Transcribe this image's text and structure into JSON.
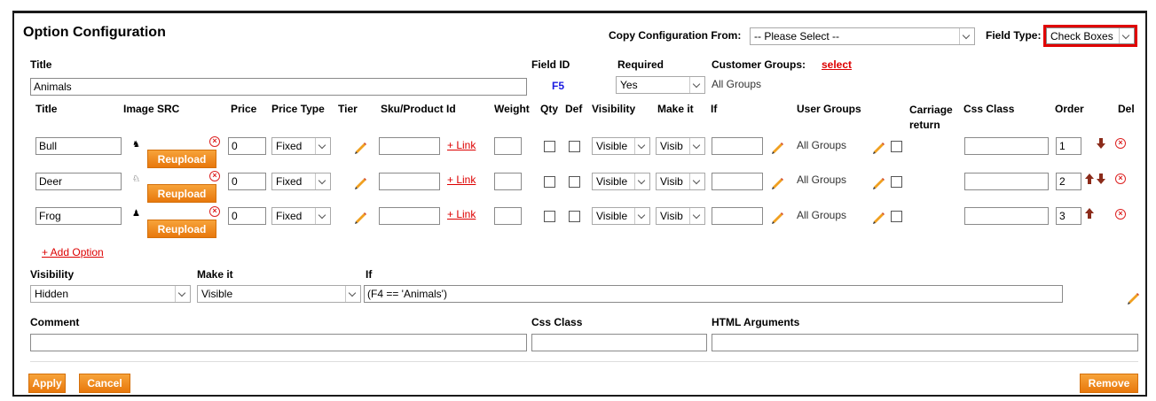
{
  "header": {
    "title": "Option Configuration",
    "copy_label": "Copy Configuration From:",
    "copy_value": "-- Please Select --",
    "field_type_label": "Field Type:",
    "field_type_value": "Check Boxes",
    "highlight_color": "#e00000"
  },
  "top": {
    "title_label": "Title",
    "title_value": "Animals",
    "field_id_label": "Field ID",
    "field_id_value": "F5",
    "required_label": "Required",
    "required_value": "Yes",
    "customer_groups_label": "Customer Groups:",
    "customer_groups_link": "select",
    "customer_groups_value": "All Groups"
  },
  "columns": {
    "title": "Title",
    "image_src": "Image SRC",
    "price": "Price",
    "price_type": "Price Type",
    "tier": "Tier",
    "sku": "Sku/Product Id",
    "weight": "Weight",
    "qty": "Qty",
    "def": "Def",
    "visibility": "Visibility",
    "make_it": "Make it",
    "if": "If",
    "user_groups": "User Groups",
    "carriage_return": "Carriage return",
    "css_class": "Css Class",
    "order": "Order",
    "del": "Del"
  },
  "rows": [
    {
      "title": "Bull",
      "price": "0",
      "price_type": "Fixed",
      "link": "+ Link",
      "visibility": "Visible",
      "make_it": "Visib",
      "user_groups": "All Groups",
      "order": "1",
      "reupload": "Reupload",
      "arrows": [
        "down"
      ]
    },
    {
      "title": "Deer",
      "price": "0",
      "price_type": "Fixed",
      "link": "+ Link",
      "visibility": "Visible",
      "make_it": "Visib",
      "user_groups": "All Groups",
      "order": "2",
      "reupload": "Reupload",
      "arrows": [
        "up",
        "down"
      ]
    },
    {
      "title": "Frog",
      "price": "0",
      "price_type": "Fixed",
      "link": "+ Link",
      "visibility": "Visible",
      "make_it": "Visib",
      "user_groups": "All Groups",
      "order": "3",
      "reupload": "Reupload",
      "arrows": [
        "up"
      ]
    }
  ],
  "add_option": "+ Add Option",
  "visibility_section": {
    "visibility_label": "Visibility",
    "visibility_value": "Hidden",
    "make_it_label": "Make it",
    "make_it_value": "Visible",
    "if_label": "If",
    "if_value": "(F4 == 'Animals')"
  },
  "bottom": {
    "comment_label": "Comment",
    "css_class_label": "Css Class",
    "html_args_label": "HTML Arguments"
  },
  "buttons": {
    "apply": "Apply",
    "cancel": "Cancel",
    "remove": "Remove"
  },
  "colors": {
    "accent_orange": "#f08a1e",
    "link_red": "#dd0000",
    "field_id_blue": "#1a1ae0"
  }
}
